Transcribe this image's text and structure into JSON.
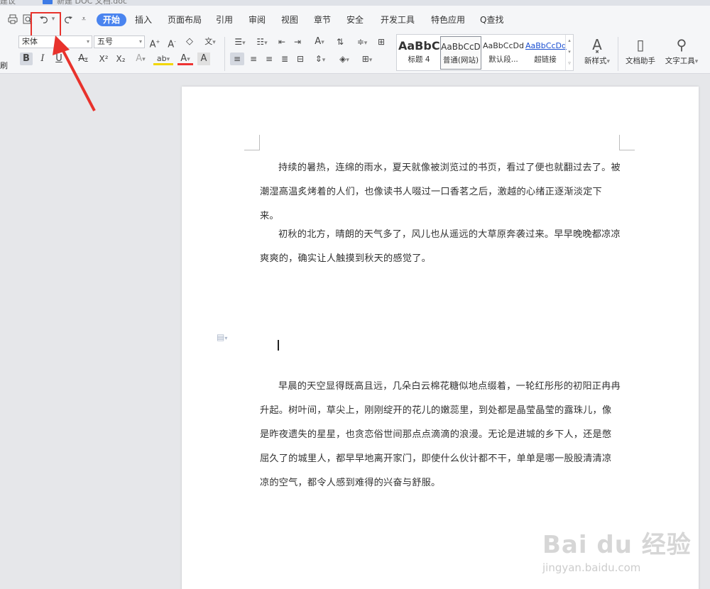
{
  "tab_strip": {
    "left_tab": "建议",
    "doc_tab": "新建 DOC 文档.doc"
  },
  "quick_access": {
    "print_icon": "printer-icon",
    "preview_icon": "print-preview-icon",
    "undo_icon": "undo-icon",
    "redo_icon": "redo-icon",
    "more_icon": "chevron-down-icon"
  },
  "menu": {
    "items": [
      "开始",
      "插入",
      "页面布局",
      "引用",
      "审阅",
      "视图",
      "章节",
      "安全",
      "开发工具",
      "特色应用"
    ],
    "search": "Q查找"
  },
  "font": {
    "family": "宋体",
    "size": "五号"
  },
  "format_buttons": {
    "bold": "B",
    "italic": "I",
    "underline": "U",
    "superscript": "X²",
    "subscript": "X₂"
  },
  "styles": [
    {
      "preview": "AaBbC",
      "caption": "标题 4"
    },
    {
      "preview": "AaBbCcD",
      "caption": "普通(网站)"
    },
    {
      "preview": "AaBbCcDd",
      "caption": "默认段..."
    },
    {
      "preview": "AaBbCcDd",
      "caption": "超链接"
    }
  ],
  "right_buttons": {
    "new_style": "新样式",
    "doc_assistant": "文档助手",
    "text_tools": "文字工具"
  },
  "gutter_label": "刷",
  "document": {
    "paragraphs": [
      "持续的暑热，连绵的雨水，夏天就像被浏览过的书页，看过了便也就翻过去了。被潮湿高温炙烤着的人们，也像读书人啜过一口香茗之后，激越的心绪正逐渐淡定下来。",
      "初秋的北方，晴朗的天气多了，风儿也从遥远的大草原奔袭过来。早早晚晚都凉凉爽爽的，确实让人触摸到秋天的感觉了。",
      "早晨的天空显得既高且远，几朵白云棉花糖似地点缀着，一轮红彤彤的初阳正冉冉升起。树叶间，草尖上，刚刚绽开的花儿的嫩蕊里，到处都是晶莹晶莹的露珠儿，像是昨夜遗失的星星，也贪恋俗世间那点点滴滴的浪漫。无论是进城的乡下人，还是憋屈久了的城里人，都早早地离开家门，即使什么伙计都不干，单单是哪一股股清清凉凉的空气，都令人感到难得的兴奋与舒服。"
    ]
  },
  "watermark": {
    "brand": "Bai du 经验",
    "site": "jingyan.baidu.com"
  },
  "colors": {
    "accent": "#4a84ef",
    "highlight_box": "#e8322c",
    "arrow": "#e8322c"
  }
}
